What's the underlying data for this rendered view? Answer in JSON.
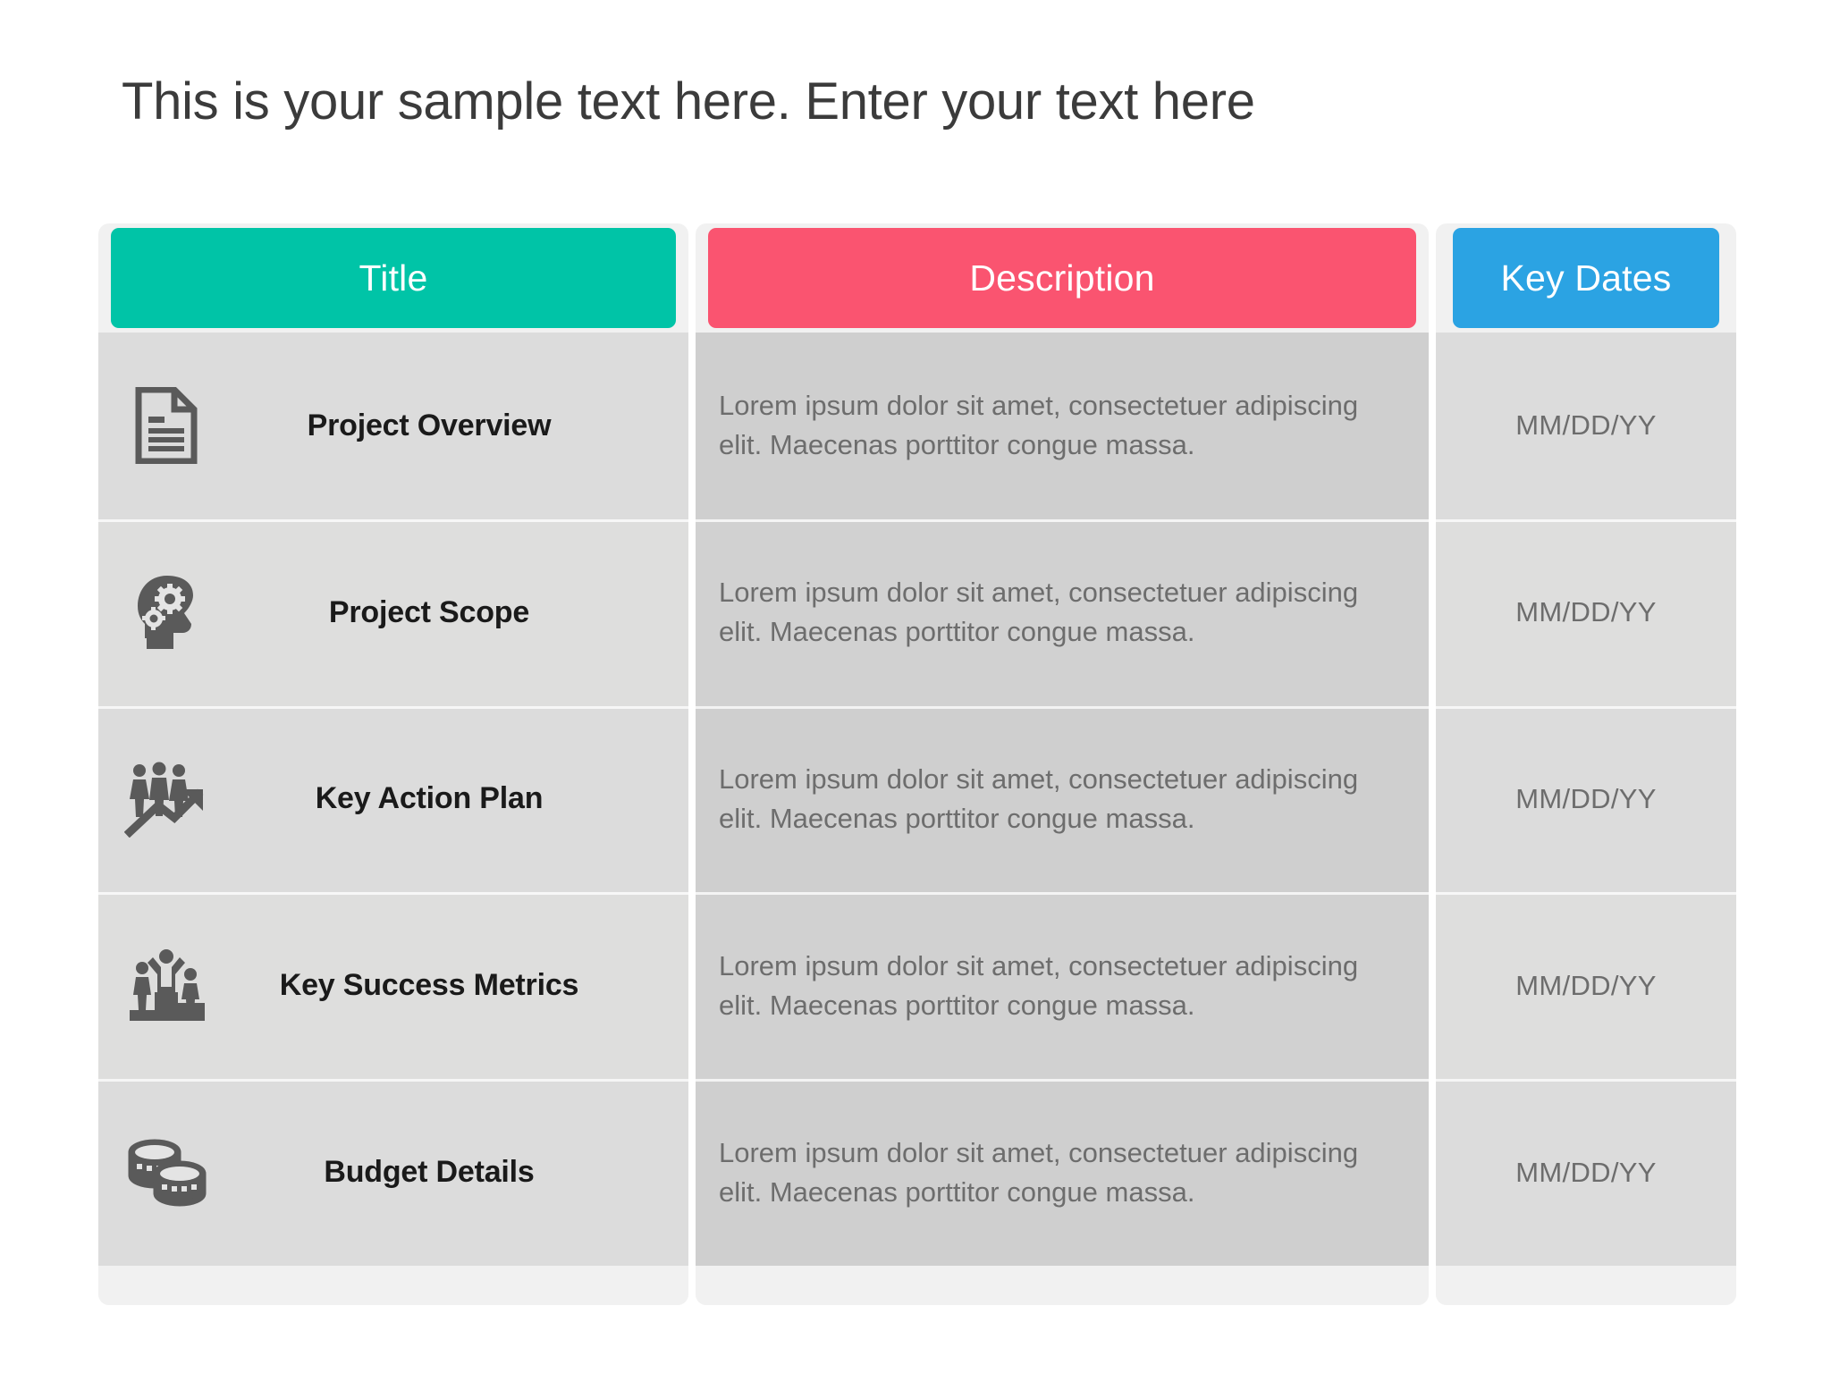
{
  "slide": {
    "title": "This is your sample text here. Enter your text here",
    "background_color": "#ffffff"
  },
  "table": {
    "columns": [
      {
        "id": "title",
        "label": "Title",
        "accent_color": "#00c4a7"
      },
      {
        "id": "description",
        "label": "Description",
        "accent_color": "#fa5470"
      },
      {
        "id": "key_dates",
        "label": "Key Dates",
        "accent_color": "#2ba3e3"
      }
    ],
    "rows": [
      {
        "icon": "document-icon",
        "title": "Project Overview",
        "description": "Lorem ipsum dolor sit amet, consectetuer adipiscing elit. Maecenas porttitor congue massa.",
        "key_date": "MM/DD/YY"
      },
      {
        "icon": "head-with-gears-icon",
        "title": "Project Scope",
        "description": "Lorem ipsum dolor sit amet, consectetuer adipiscing elit. Maecenas porttitor congue massa.",
        "key_date": "MM/DD/YY"
      },
      {
        "icon": "people-growth-chart-icon",
        "title": "Key Action Plan",
        "description": "Lorem ipsum dolor sit amet, consectetuer adipiscing elit. Maecenas porttitor congue massa.",
        "key_date": "MM/DD/YY"
      },
      {
        "icon": "podium-winners-icon",
        "title": "Key Success Metrics",
        "description": "Lorem ipsum dolor sit amet, consectetuer adipiscing elit. Maecenas porttitor congue massa.",
        "key_date": "MM/DD/YY"
      },
      {
        "icon": "stacked-coins-icon",
        "title": "Budget Details",
        "description": "Lorem ipsum dolor sit amet, consectetuer adipiscing elit. Maecenas porttitor congue massa.",
        "key_date": "MM/DD/YY"
      }
    ]
  }
}
